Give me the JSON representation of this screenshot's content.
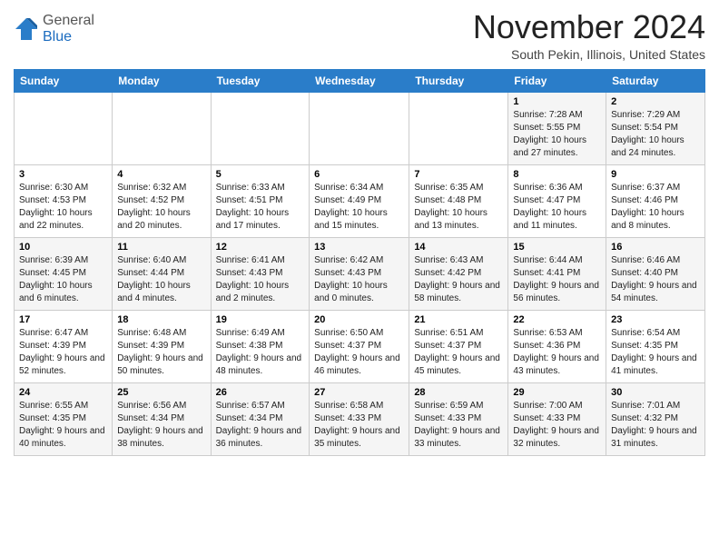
{
  "header": {
    "logo_general": "General",
    "logo_blue": "Blue",
    "month_title": "November 2024",
    "location": "South Pekin, Illinois, United States"
  },
  "weekdays": [
    "Sunday",
    "Monday",
    "Tuesday",
    "Wednesday",
    "Thursday",
    "Friday",
    "Saturday"
  ],
  "weeks": [
    [
      {
        "day": "",
        "info": ""
      },
      {
        "day": "",
        "info": ""
      },
      {
        "day": "",
        "info": ""
      },
      {
        "day": "",
        "info": ""
      },
      {
        "day": "",
        "info": ""
      },
      {
        "day": "1",
        "info": "Sunrise: 7:28 AM\nSunset: 5:55 PM\nDaylight: 10 hours and 27 minutes."
      },
      {
        "day": "2",
        "info": "Sunrise: 7:29 AM\nSunset: 5:54 PM\nDaylight: 10 hours and 24 minutes."
      }
    ],
    [
      {
        "day": "3",
        "info": "Sunrise: 6:30 AM\nSunset: 4:53 PM\nDaylight: 10 hours and 22 minutes."
      },
      {
        "day": "4",
        "info": "Sunrise: 6:32 AM\nSunset: 4:52 PM\nDaylight: 10 hours and 20 minutes."
      },
      {
        "day": "5",
        "info": "Sunrise: 6:33 AM\nSunset: 4:51 PM\nDaylight: 10 hours and 17 minutes."
      },
      {
        "day": "6",
        "info": "Sunrise: 6:34 AM\nSunset: 4:49 PM\nDaylight: 10 hours and 15 minutes."
      },
      {
        "day": "7",
        "info": "Sunrise: 6:35 AM\nSunset: 4:48 PM\nDaylight: 10 hours and 13 minutes."
      },
      {
        "day": "8",
        "info": "Sunrise: 6:36 AM\nSunset: 4:47 PM\nDaylight: 10 hours and 11 minutes."
      },
      {
        "day": "9",
        "info": "Sunrise: 6:37 AM\nSunset: 4:46 PM\nDaylight: 10 hours and 8 minutes."
      }
    ],
    [
      {
        "day": "10",
        "info": "Sunrise: 6:39 AM\nSunset: 4:45 PM\nDaylight: 10 hours and 6 minutes."
      },
      {
        "day": "11",
        "info": "Sunrise: 6:40 AM\nSunset: 4:44 PM\nDaylight: 10 hours and 4 minutes."
      },
      {
        "day": "12",
        "info": "Sunrise: 6:41 AM\nSunset: 4:43 PM\nDaylight: 10 hours and 2 minutes."
      },
      {
        "day": "13",
        "info": "Sunrise: 6:42 AM\nSunset: 4:43 PM\nDaylight: 10 hours and 0 minutes."
      },
      {
        "day": "14",
        "info": "Sunrise: 6:43 AM\nSunset: 4:42 PM\nDaylight: 9 hours and 58 minutes."
      },
      {
        "day": "15",
        "info": "Sunrise: 6:44 AM\nSunset: 4:41 PM\nDaylight: 9 hours and 56 minutes."
      },
      {
        "day": "16",
        "info": "Sunrise: 6:46 AM\nSunset: 4:40 PM\nDaylight: 9 hours and 54 minutes."
      }
    ],
    [
      {
        "day": "17",
        "info": "Sunrise: 6:47 AM\nSunset: 4:39 PM\nDaylight: 9 hours and 52 minutes."
      },
      {
        "day": "18",
        "info": "Sunrise: 6:48 AM\nSunset: 4:39 PM\nDaylight: 9 hours and 50 minutes."
      },
      {
        "day": "19",
        "info": "Sunrise: 6:49 AM\nSunset: 4:38 PM\nDaylight: 9 hours and 48 minutes."
      },
      {
        "day": "20",
        "info": "Sunrise: 6:50 AM\nSunset: 4:37 PM\nDaylight: 9 hours and 46 minutes."
      },
      {
        "day": "21",
        "info": "Sunrise: 6:51 AM\nSunset: 4:37 PM\nDaylight: 9 hours and 45 minutes."
      },
      {
        "day": "22",
        "info": "Sunrise: 6:53 AM\nSunset: 4:36 PM\nDaylight: 9 hours and 43 minutes."
      },
      {
        "day": "23",
        "info": "Sunrise: 6:54 AM\nSunset: 4:35 PM\nDaylight: 9 hours and 41 minutes."
      }
    ],
    [
      {
        "day": "24",
        "info": "Sunrise: 6:55 AM\nSunset: 4:35 PM\nDaylight: 9 hours and 40 minutes."
      },
      {
        "day": "25",
        "info": "Sunrise: 6:56 AM\nSunset: 4:34 PM\nDaylight: 9 hours and 38 minutes."
      },
      {
        "day": "26",
        "info": "Sunrise: 6:57 AM\nSunset: 4:34 PM\nDaylight: 9 hours and 36 minutes."
      },
      {
        "day": "27",
        "info": "Sunrise: 6:58 AM\nSunset: 4:33 PM\nDaylight: 9 hours and 35 minutes."
      },
      {
        "day": "28",
        "info": "Sunrise: 6:59 AM\nSunset: 4:33 PM\nDaylight: 9 hours and 33 minutes."
      },
      {
        "day": "29",
        "info": "Sunrise: 7:00 AM\nSunset: 4:33 PM\nDaylight: 9 hours and 32 minutes."
      },
      {
        "day": "30",
        "info": "Sunrise: 7:01 AM\nSunset: 4:32 PM\nDaylight: 9 hours and 31 minutes."
      }
    ]
  ]
}
